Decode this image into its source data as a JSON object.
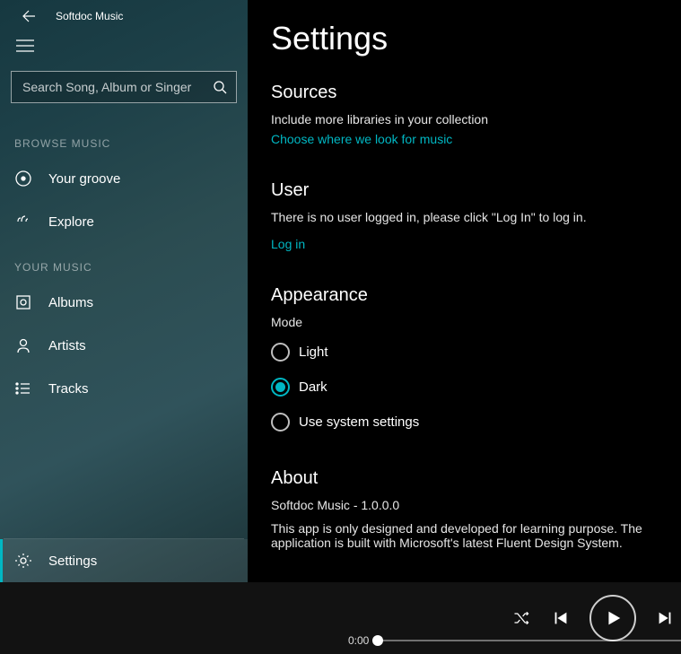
{
  "app": {
    "title": "Softdoc Music"
  },
  "search": {
    "placeholder": "Search Song, Album or Singer"
  },
  "sidebar": {
    "browse_label": "BROWSE MUSIC",
    "your_music_label": "YOUR MUSIC",
    "browse": [
      {
        "label": "Your groove"
      },
      {
        "label": "Explore"
      }
    ],
    "music": [
      {
        "label": "Albums"
      },
      {
        "label": "Artists"
      },
      {
        "label": "Tracks"
      }
    ],
    "settings_label": "Settings"
  },
  "main": {
    "title": "Settings",
    "sources": {
      "heading": "Sources",
      "text": "Include more libraries in your collection",
      "link": "Choose where we look for music"
    },
    "user": {
      "heading": "User",
      "text": "There is no user logged in, please click \"Log In\" to log in.",
      "link": "Log in"
    },
    "appearance": {
      "heading": "Appearance",
      "mode_label": "Mode",
      "options": [
        {
          "label": "Light",
          "selected": false
        },
        {
          "label": "Dark",
          "selected": true
        },
        {
          "label": "Use system settings",
          "selected": false
        }
      ]
    },
    "about": {
      "heading": "About",
      "version": "Softdoc Music - 1.0.0.0",
      "text": "This app is only designed and developed for learning purpose. The application is built with Microsoft's latest Fluent Design System."
    }
  },
  "player": {
    "time": "0:00"
  }
}
